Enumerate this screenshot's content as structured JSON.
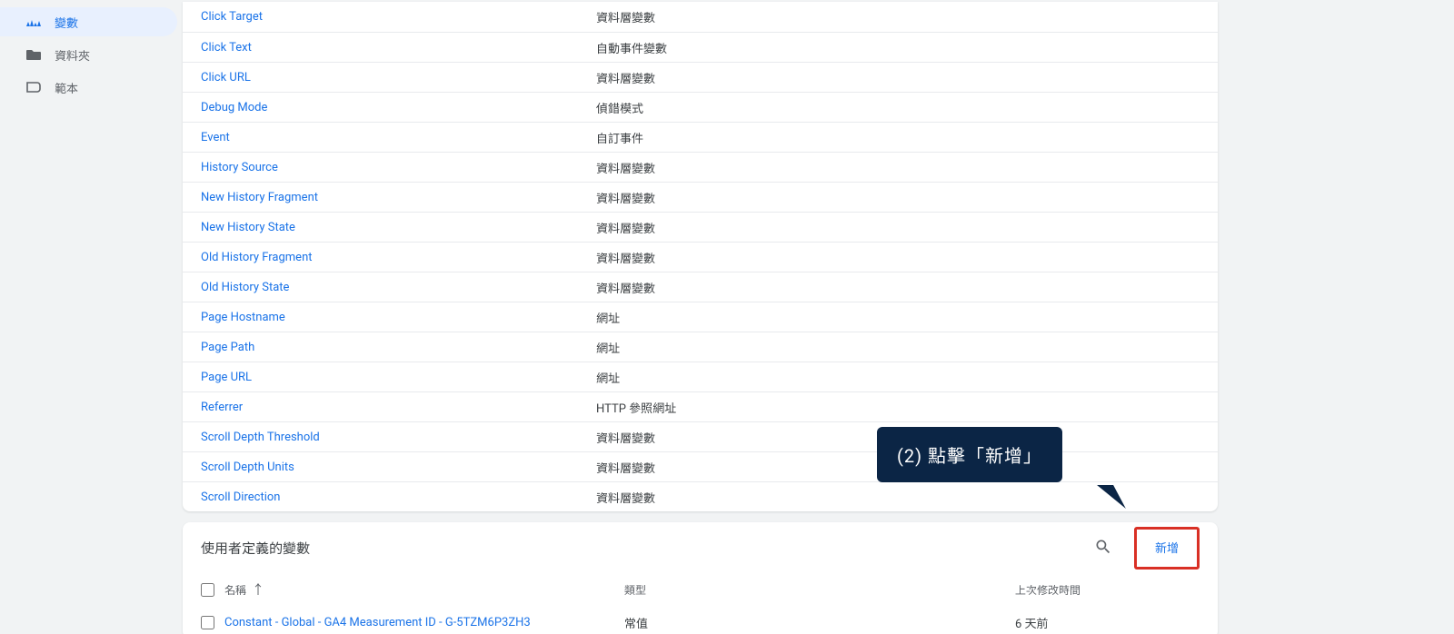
{
  "sidebar": {
    "variables": "變數",
    "folder": "資料夾",
    "template": "範本"
  },
  "builtin_rows": [
    {
      "name": "Click Target",
      "type": "資料層變數"
    },
    {
      "name": "Click Text",
      "type": "自動事件變數"
    },
    {
      "name": "Click URL",
      "type": "資料層變數"
    },
    {
      "name": "Debug Mode",
      "type": "偵錯模式"
    },
    {
      "name": "Event",
      "type": "自訂事件"
    },
    {
      "name": "History Source",
      "type": "資料層變數"
    },
    {
      "name": "New History Fragment",
      "type": "資料層變數"
    },
    {
      "name": "New History State",
      "type": "資料層變數"
    },
    {
      "name": "Old History Fragment",
      "type": "資料層變數"
    },
    {
      "name": "Old History State",
      "type": "資料層變數"
    },
    {
      "name": "Page Hostname",
      "type": "網址"
    },
    {
      "name": "Page Path",
      "type": "網址"
    },
    {
      "name": "Page URL",
      "type": "網址"
    },
    {
      "name": "Referrer",
      "type": "HTTP 參照網址"
    },
    {
      "name": "Scroll Depth Threshold",
      "type": "資料層變數"
    },
    {
      "name": "Scroll Depth Units",
      "type": "資料層變數"
    },
    {
      "name": "Scroll Direction",
      "type": "資料層變數"
    }
  ],
  "user_section": {
    "title": "使用者定義的變數",
    "new_label": "新增",
    "cols": {
      "name": "名稱",
      "type": "類型",
      "modified": "上次修改時間"
    },
    "rows": [
      {
        "name": "Constant - Global - GA4 Measurement ID - G-5TZM6P3ZH3",
        "type": "常值",
        "modified": "6 天前"
      }
    ]
  },
  "callout_text": "(2) 點擊「新增」"
}
